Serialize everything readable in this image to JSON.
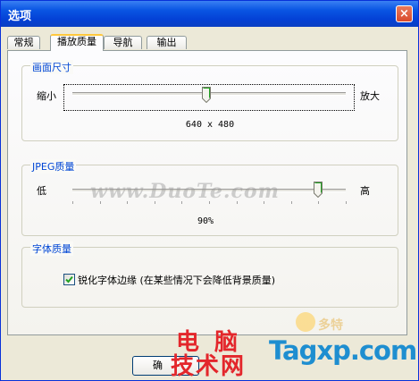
{
  "window": {
    "title": "选项",
    "close_glyph": "×"
  },
  "tabs": [
    {
      "label": "常规",
      "active": false
    },
    {
      "label": "播放质量",
      "active": true
    },
    {
      "label": "导航",
      "active": false
    },
    {
      "label": "输出",
      "active": false
    }
  ],
  "screen_size": {
    "title": "画面尺寸",
    "min_label": "缩小",
    "max_label": "放大",
    "value_text": "640 x 480",
    "slider_fraction": 0.49
  },
  "jpeg_quality": {
    "title": "JPEG质量",
    "min_label": "低",
    "max_label": "高",
    "value_text": "90%",
    "slider_fraction": 0.9
  },
  "font_quality": {
    "title": "字体质量",
    "checkbox_label": "锐化字体边缘 (在某些情况下会降低背景质量)",
    "checked": true
  },
  "buttons": {
    "ok_label": "确"
  },
  "watermarks": {
    "duote_text": "www.DuoTe.com",
    "duote_corner_text": "多特",
    "diannao_line1": "电 脑",
    "diannao_line2": "技术网",
    "tagxp_text": "Tagxp.com"
  },
  "colors": {
    "titlebar": "#0a56e3",
    "group_title": "#0046d5",
    "tab_highlight": "#ffc83c",
    "watermark_red": "#e3262b",
    "watermark_blue": "#1e8ed0"
  }
}
